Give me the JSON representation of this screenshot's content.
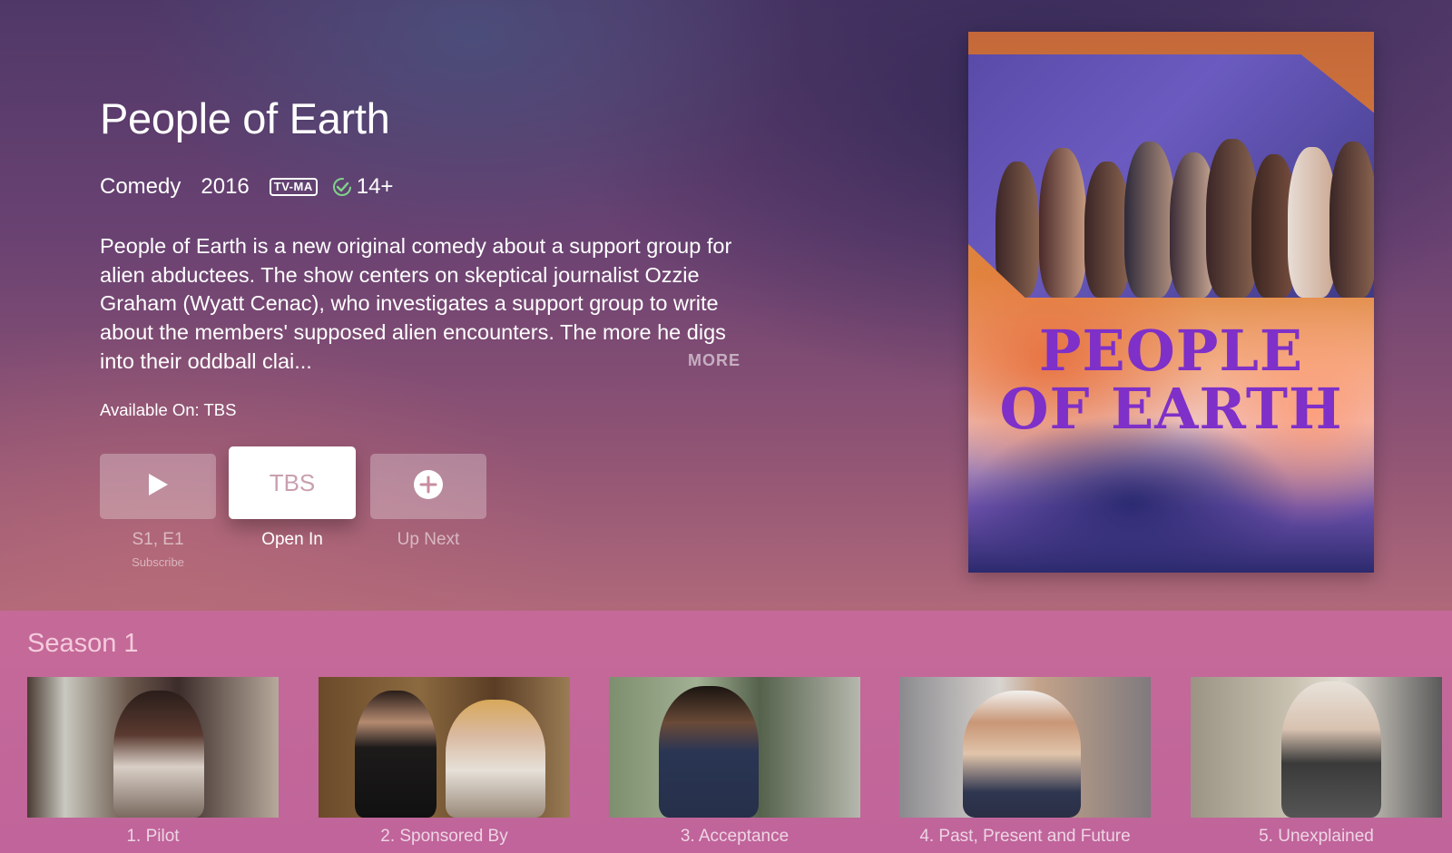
{
  "show": {
    "title": "People of Earth",
    "genre": "Comedy",
    "year": "2016",
    "rating": "TV-MA",
    "age_rating": "14+",
    "description": "People of Earth is a new original comedy about a support group for alien abductees. The show centers on skeptical journalist Ozzie Graham (Wyatt Cenac), who investigates a support group to write about the members' supposed alien encounters. The more he digs into their oddball clai...",
    "more_label": "MORE",
    "available_on": "Available On: TBS"
  },
  "actions": {
    "play_label": "S1, E1",
    "play_sublabel": "Subscribe",
    "open_in_button_text": "TBS",
    "open_in_label": "Open In",
    "up_next_label": "Up Next"
  },
  "poster": {
    "title_line1": "PEOPLE",
    "title_line2": "OF EARTH"
  },
  "season": {
    "title": "Season 1",
    "episodes": [
      {
        "title": "1. Pilot"
      },
      {
        "title": "2. Sponsored By"
      },
      {
        "title": "3. Acceptance"
      },
      {
        "title": "4. Past, Present and Future"
      },
      {
        "title": "5. Unexplained"
      }
    ]
  },
  "colors": {
    "background_top": "#4f3868",
    "background_bottom": "#b86b84",
    "season_strip": "#c56a98",
    "poster_title": "#7e30c8",
    "focused_button": "#ffffff"
  },
  "icons": {
    "play": "play-icon",
    "add": "plus-circle-icon",
    "check": "check-icon"
  }
}
